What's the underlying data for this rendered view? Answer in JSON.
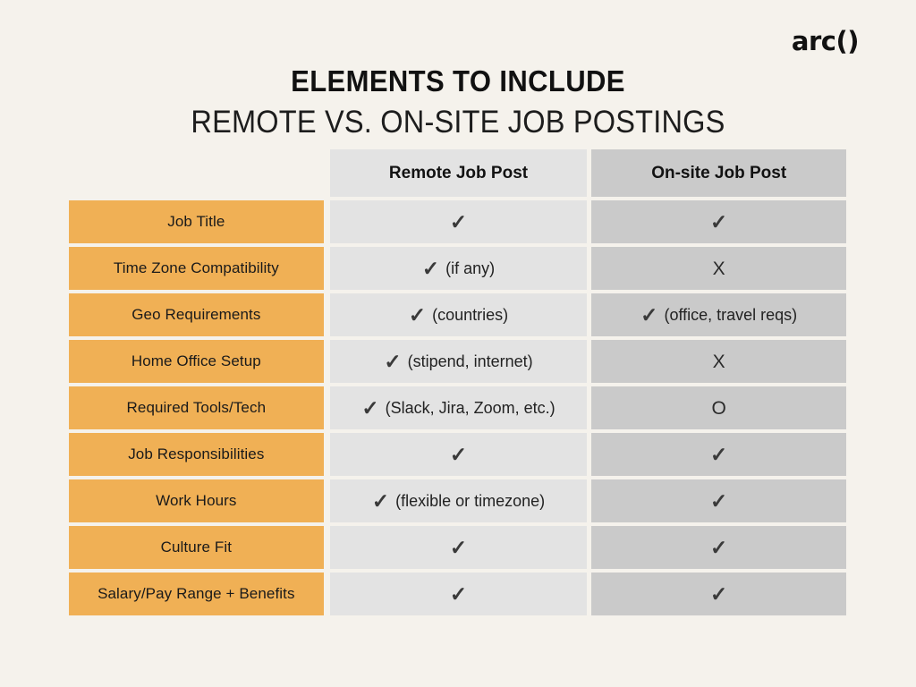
{
  "brand": {
    "logo_text": "arc()"
  },
  "titles": {
    "main": "ELEMENTS TO INCLUDE",
    "sub": "REMOTE VS. ON-SITE JOB POSTINGS"
  },
  "colors": {
    "background": "#F5F2EC",
    "label_orange": "#F0B055",
    "remote_gray": "#E3E3E3",
    "onsite_gray": "#CACACA",
    "text_dark": "#1a1a1a",
    "mark_gray": "#3a3a3a"
  },
  "table": {
    "columns": [
      {
        "key": "element",
        "header": ""
      },
      {
        "key": "remote",
        "header": "Remote Job Post"
      },
      {
        "key": "onsite",
        "header": "On-site Job Post"
      }
    ],
    "rows": [
      {
        "label": "Job Title",
        "remote": {
          "mark": "✓",
          "note": ""
        },
        "onsite": {
          "mark": "✓",
          "note": ""
        }
      },
      {
        "label": "Time Zone Compatibility",
        "remote": {
          "mark": "✓",
          "note": "(if any)"
        },
        "onsite": {
          "mark": "X",
          "note": ""
        }
      },
      {
        "label": "Geo Requirements",
        "remote": {
          "mark": "✓",
          "note": "(countries)"
        },
        "onsite": {
          "mark": "✓",
          "note": "(office, travel reqs)"
        }
      },
      {
        "label": "Home Office Setup",
        "remote": {
          "mark": "✓",
          "note": "(stipend, internet)"
        },
        "onsite": {
          "mark": "X",
          "note": ""
        }
      },
      {
        "label": "Required Tools/Tech",
        "remote": {
          "mark": "✓",
          "note": "(Slack, Jira, Zoom, etc.)"
        },
        "onsite": {
          "mark": "O",
          "note": ""
        }
      },
      {
        "label": "Job Responsibilities",
        "remote": {
          "mark": "✓",
          "note": ""
        },
        "onsite": {
          "mark": "✓",
          "note": ""
        }
      },
      {
        "label": "Work Hours",
        "remote": {
          "mark": "✓",
          "note": "(flexible or timezone)"
        },
        "onsite": {
          "mark": "✓",
          "note": ""
        }
      },
      {
        "label": "Culture Fit",
        "remote": {
          "mark": "✓",
          "note": ""
        },
        "onsite": {
          "mark": "✓",
          "note": ""
        }
      },
      {
        "label": "Salary/Pay Range + Benefits",
        "remote": {
          "mark": "✓",
          "note": ""
        },
        "onsite": {
          "mark": "✓",
          "note": ""
        }
      }
    ]
  }
}
